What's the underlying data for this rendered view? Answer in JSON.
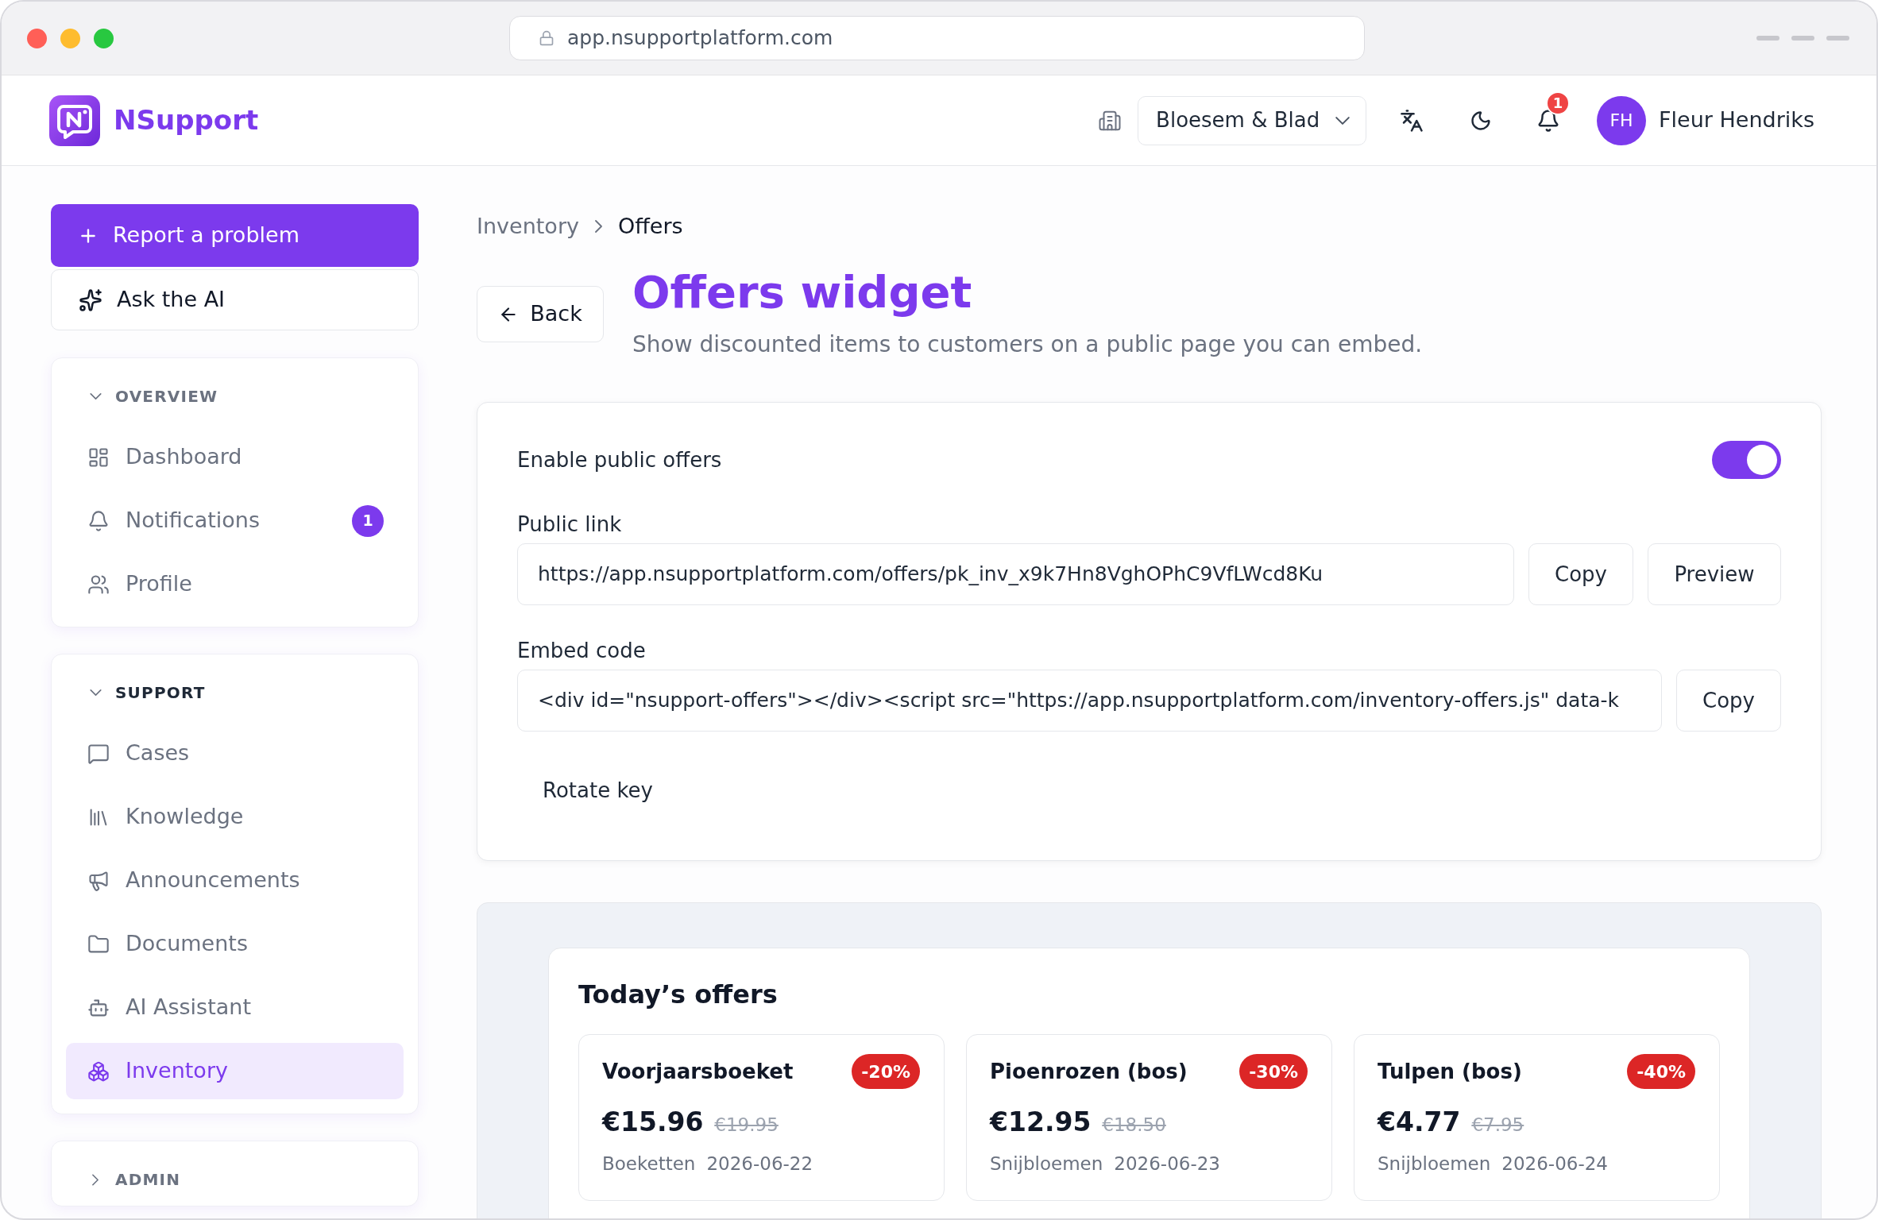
{
  "browser": {
    "url": "app.nsupportplatform.com"
  },
  "header": {
    "brand": "NSupport",
    "workspace": "Bloesem & Blad",
    "notification_count": "1",
    "user": {
      "initials": "FH",
      "name": "Fleur Hendriks"
    }
  },
  "sidebar": {
    "actions": [
      {
        "kind": "primary",
        "label": "Report a problem"
      },
      {
        "kind": "secondary",
        "label": "Ask the AI"
      }
    ],
    "sections": [
      {
        "title": "OVERVIEW",
        "expanded": true,
        "items": [
          {
            "label": "Dashboard",
            "selected": false
          },
          {
            "label": "Notifications",
            "badge": "1",
            "selected": false
          },
          {
            "label": "Profile",
            "selected": false
          }
        ]
      },
      {
        "title": "SUPPORT",
        "expanded": true,
        "items": [
          {
            "label": "Cases",
            "selected": false
          },
          {
            "label": "Knowledge",
            "selected": false
          },
          {
            "label": "Announcements",
            "selected": false
          },
          {
            "label": "Documents",
            "selected": false
          },
          {
            "label": "AI Assistant",
            "selected": false
          },
          {
            "label": "Inventory",
            "selected": true
          }
        ]
      },
      {
        "title": "ADMIN",
        "expanded": false
      }
    ]
  },
  "breadcrumb": [
    "Inventory",
    "Offers"
  ],
  "back_button": "Back",
  "title": "Offers widget",
  "subtitle": "Show discounted items to customers on a public page you can embed.",
  "settings": {
    "enable": {
      "label": "Enable public offers",
      "on": true
    },
    "fields": [
      {
        "label": "Public link",
        "value": "https://app.nsupportplatform.com/offers/pk_inv_x9k7Hn8VghOPhC9VfLWcd8Ku",
        "buttons": [
          "Copy",
          "Preview"
        ]
      },
      {
        "label": "Embed code",
        "value": "<div id=\"nsupport-offers\"></div><script src=\"https://app.nsupportplatform.com/inventory-offers.js\" data-k",
        "buttons": [
          "Copy"
        ]
      }
    ],
    "rotate_key": "Rotate key"
  },
  "preview": {
    "title": "Today’s offers",
    "offers": [
      {
        "name": "Voorjaarsboeket",
        "discount": "-20%",
        "price": "€15.96",
        "original_price": "€19.95",
        "category": "Boeketten",
        "date": "2026-06-22"
      },
      {
        "name": "Pioenrozen (bos)",
        "discount": "-30%",
        "price": "€12.95",
        "original_price": "€18.50",
        "category": "Snijbloemen",
        "date": "2026-06-23"
      },
      {
        "name": "Tulpen (bos)",
        "discount": "-40%",
        "price": "€4.77",
        "original_price": "€7.95",
        "category": "Snijbloemen",
        "date": "2026-06-24"
      }
    ]
  }
}
